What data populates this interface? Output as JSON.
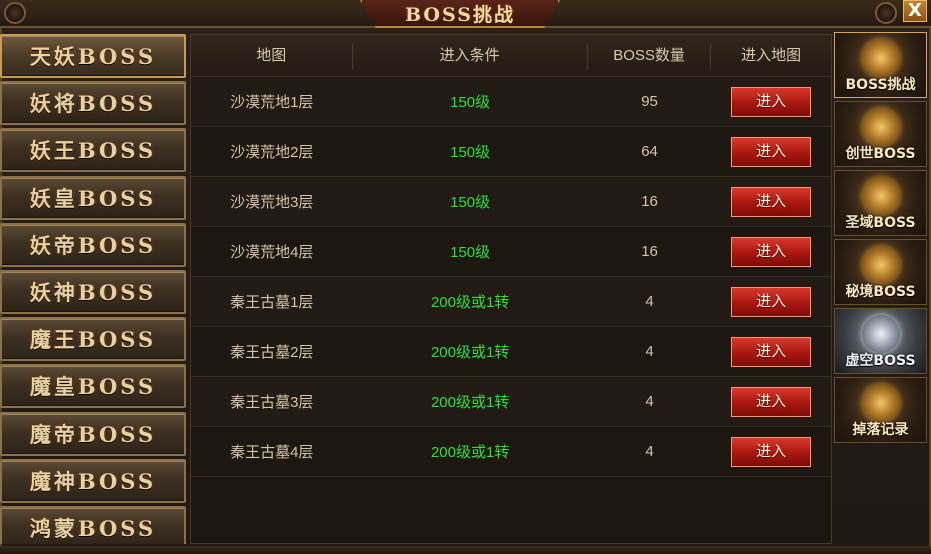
{
  "window": {
    "title": "BOSS挑战",
    "close_label": "X"
  },
  "left_menu": {
    "items": [
      {
        "label": "天妖BOSS",
        "active": true
      },
      {
        "label": "妖将BOSS",
        "active": false
      },
      {
        "label": "妖王BOSS",
        "active": false
      },
      {
        "label": "妖皇BOSS",
        "active": false
      },
      {
        "label": "妖帝BOSS",
        "active": false
      },
      {
        "label": "妖神BOSS",
        "active": false
      },
      {
        "label": "魔王BOSS",
        "active": false
      },
      {
        "label": "魔皇BOSS",
        "active": false
      },
      {
        "label": "魔帝BOSS",
        "active": false
      },
      {
        "label": "魔神BOSS",
        "active": false
      },
      {
        "label": "鸿蒙BOSS",
        "active": false
      }
    ]
  },
  "table": {
    "headers": [
      "地图",
      "进入条件",
      "BOSS数量",
      "进入地图"
    ],
    "rows": [
      {
        "map": "沙漠荒地1层",
        "requirement": "150级",
        "count": "95",
        "action": "进入"
      },
      {
        "map": "沙漠荒地2层",
        "requirement": "150级",
        "count": "64",
        "action": "进入"
      },
      {
        "map": "沙漠荒地3层",
        "requirement": "150级",
        "count": "16",
        "action": "进入"
      },
      {
        "map": "沙漠荒地4层",
        "requirement": "150级",
        "count": "16",
        "action": "进入"
      },
      {
        "map": "秦王古墓1层",
        "requirement": "200级或1转",
        "count": "4",
        "action": "进入"
      },
      {
        "map": "秦王古墓2层",
        "requirement": "200级或1转",
        "count": "4",
        "action": "进入"
      },
      {
        "map": "秦王古墓3层",
        "requirement": "200级或1转",
        "count": "4",
        "action": "进入"
      },
      {
        "map": "秦王古墓4层",
        "requirement": "200级或1转",
        "count": "4",
        "action": "进入"
      }
    ]
  },
  "right_tabs": {
    "items": [
      {
        "label": "BOSS挑战",
        "icon": "boss-challenge-emblem-icon",
        "active": true
      },
      {
        "label": "创世BOSS",
        "icon": "genesis-emblem-icon",
        "active": false
      },
      {
        "label": "圣域BOSS",
        "icon": "sanctum-emblem-icon",
        "active": false
      },
      {
        "label": "秘境BOSS",
        "icon": "secret-realm-emblem-icon",
        "active": false
      },
      {
        "label": "虚空BOSS",
        "icon": "void-emblem-icon",
        "active": false
      },
      {
        "label": "掉落记录",
        "icon": "drop-record-scroll-icon",
        "active": false
      }
    ]
  },
  "colors": {
    "requirement_text": "#2fe02f",
    "enter_button": "#b81a12",
    "frame_gold": "#8b7048"
  }
}
